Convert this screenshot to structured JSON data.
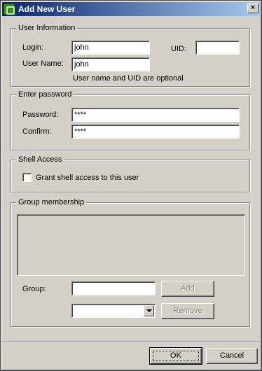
{
  "window": {
    "title": "Add New User",
    "close_glyph": "×",
    "icon": "app-icon"
  },
  "user_info": {
    "legend": "User Information",
    "login_label": "Login:",
    "login_value": "john",
    "uid_label": "UID:",
    "uid_value": "",
    "username_label": "User Name:",
    "username_value": "john",
    "hint": "User name and UID are optional"
  },
  "password": {
    "legend": "Enter password",
    "password_label": "Password:",
    "password_value": "****",
    "confirm_label": "Confirm:",
    "confirm_value": "****"
  },
  "shell": {
    "legend": "Shell Access",
    "checkbox_label": "Grant shell access to this user",
    "checked": false
  },
  "groups": {
    "legend": "Group membership",
    "group_label": "Group:",
    "group_value": "",
    "add_label": "Add",
    "remove_label": "Remove",
    "combo_value": ""
  },
  "footer": {
    "ok_label": "OK",
    "cancel_label": "Cancel"
  },
  "colors": {
    "face": "#d4d0c8",
    "title_start": "#0a246a",
    "title_end": "#a6caf0",
    "disabled_text": "#808080"
  }
}
